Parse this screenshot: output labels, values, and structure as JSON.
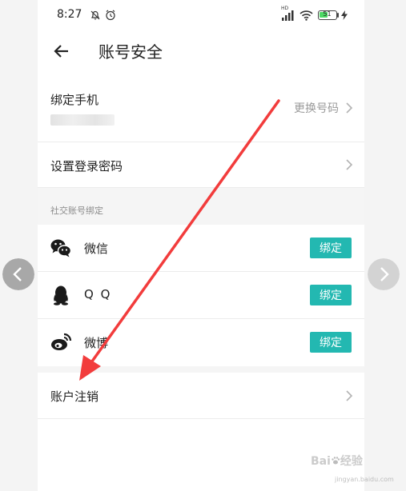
{
  "status_bar": {
    "time": "8:27",
    "network_label": "HD",
    "battery_level": "51",
    "battery_fraction": 0.51,
    "icons": [
      "dnd-icon",
      "alarm-icon",
      "signal-icon",
      "wifi-icon",
      "battery-icon",
      "charging-icon"
    ]
  },
  "header": {
    "back_icon": "arrow-left-icon",
    "title": "账号安全"
  },
  "phone_row": {
    "label": "绑定手机",
    "action": "更换号码"
  },
  "password_row": {
    "label": "设置登录密码"
  },
  "social_section": {
    "title": "社交账号绑定",
    "items": [
      {
        "name": "微信",
        "icon": "wechat-icon",
        "button": "绑定"
      },
      {
        "name": "Q Q",
        "icon": "qq-icon",
        "button": "绑定"
      },
      {
        "name": "微博",
        "icon": "weibo-icon",
        "button": "绑定"
      }
    ]
  },
  "cancel_row": {
    "label": "账户注销"
  },
  "watermark": {
    "brand_left": "Bai",
    "brand_right": "经验",
    "url": "jingyan.baidu.com"
  },
  "colors": {
    "accent": "#23b8b1",
    "annotation_arrow": "#f23c3c",
    "band": "#f5f5f5"
  }
}
